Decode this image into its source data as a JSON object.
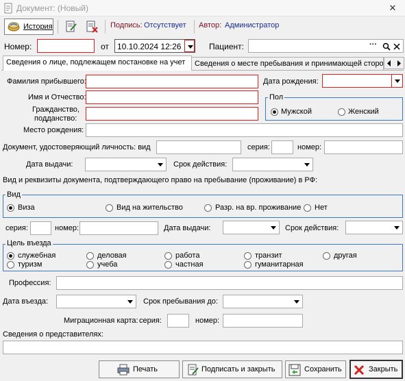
{
  "window": {
    "title": "Документ: (Новый)",
    "close_symbol": "✕"
  },
  "toolbar": {
    "history_label": "История",
    "signature_label": "Подпись:",
    "signature_value": "Отсутствует",
    "author_label": "Автор:",
    "author_value": "Администратор"
  },
  "header": {
    "number_label": "Номер:",
    "number_value": "",
    "date_label": "от",
    "date_value": "10.10.2024 12:26",
    "patient_label": "Пациент:",
    "patient_value": "",
    "ellipsis": "···",
    "magnifier": "🔍",
    "clear_x": "✕"
  },
  "tabs": [
    {
      "label": "Сведения о лице, подлежащем постановке на учет",
      "active": true
    },
    {
      "label": "Сведения о месте пребывания и принимающей сторо",
      "active": false
    }
  ],
  "person": {
    "surname_label": "Фамилия прибывшего:",
    "birthdate_label": "Дата рождения:",
    "name_label": "Имя и Отчество:",
    "citizenship_label_1": "Гражданство,",
    "citizenship_label_2": "подданство:",
    "birthplace_label": "Место рождения:",
    "gender": {
      "title": "Пол",
      "options": [
        "Мужской",
        "Женский"
      ],
      "selected": 0
    }
  },
  "identity_doc": {
    "label": "Документ, удостоверяющий личность: вид",
    "series_label": "серия:",
    "number_label": "номер:",
    "issue_date_label": "Дата выдачи:",
    "validity_label": "Срок действия:"
  },
  "stay_rights": {
    "heading": "Вид и реквизиты документа, подтверждающего право на пребывание (проживание) в РФ:",
    "kind": {
      "title": "Вид",
      "options": [
        "Виза",
        "Вид на жительство",
        "Разр. на вр. проживание",
        "Нет"
      ],
      "selected": 0
    },
    "series_label": "серия:",
    "number_label": "номер:",
    "issue_date_label": "Дата выдачи:",
    "validity_label": "Срок действия:"
  },
  "purpose": {
    "title": "Цель въезда",
    "options": [
      "служебная",
      "деловая",
      "работа",
      "транзит",
      "другая",
      "туризм",
      "учеба",
      "частная",
      "гуманитарная"
    ],
    "selected": 0
  },
  "travel": {
    "profession_label": "Профессия:",
    "entry_date_label": "Дата въезда:",
    "stay_until_label": "Срок пребывания до:",
    "migration_card_label": "Миграционная карта:",
    "mc_series_label": "серия:",
    "mc_number_label": "номер:",
    "representatives_label": "Сведения о представителях:"
  },
  "buttons": {
    "print": "Печать",
    "sign_close": "Подписать и закрыть",
    "save": "Сохранить",
    "close": "Закрыть"
  },
  "colors": {
    "accent_red": "#e02020",
    "group_border": "#3a78c8",
    "link_blue": "#1a2f8c",
    "dark_red": "#7a1020"
  }
}
